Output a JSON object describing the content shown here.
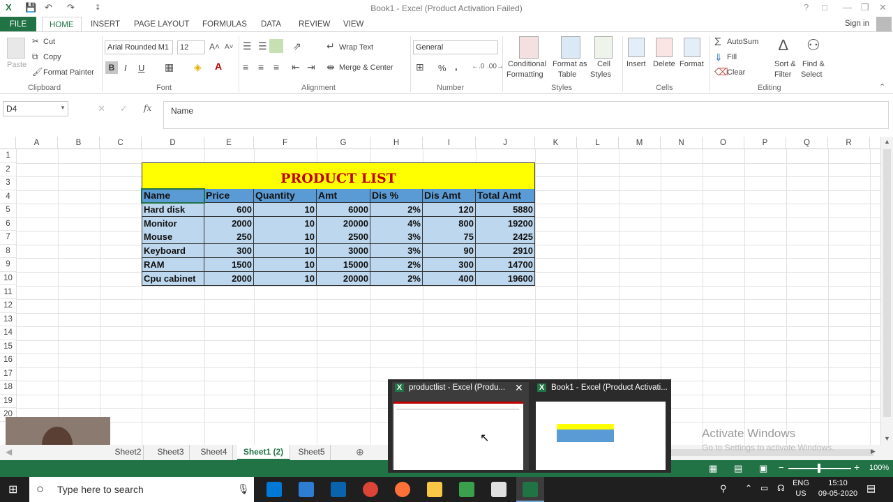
{
  "window": {
    "title": "Book1 - Excel (Product Activation Failed)",
    "sign_in": "Sign in"
  },
  "ribbon_tabs": [
    "FILE",
    "HOME",
    "INSERT",
    "PAGE LAYOUT",
    "FORMULAS",
    "DATA",
    "REVIEW",
    "VIEW"
  ],
  "clipboard": {
    "paste": "Paste",
    "cut": "Cut",
    "copy": "Copy",
    "format_painter": "Format Painter",
    "label": "Clipboard"
  },
  "font": {
    "name": "Arial Rounded M1",
    "size": "12",
    "label": "Font",
    "bold": "B",
    "italic": "I",
    "underline": "U"
  },
  "alignment": {
    "wrap_text": "Wrap Text",
    "merge_center": "Merge & Center",
    "label": "Alignment"
  },
  "number": {
    "format": "General",
    "label": "Number",
    "percent": "%",
    "comma": ","
  },
  "styles": {
    "conditional": "Conditional",
    "formatting": "Formatting",
    "format_as": "Format as",
    "table": "Table",
    "cell": "Cell",
    "cell_styles": "Styles",
    "label": "Styles"
  },
  "cells": {
    "insert": "Insert",
    "delete": "Delete",
    "format": "Format",
    "label": "Cells"
  },
  "editing": {
    "autosum": "AutoSum",
    "fill": "Fill",
    "clear": "Clear",
    "sort": "Sort &",
    "filter": "Filter",
    "find": "Find &",
    "select": "Select",
    "label": "Editing"
  },
  "formula_bar": {
    "name_box": "D4",
    "fx": "fx",
    "content": "Name"
  },
  "columns": [
    "A",
    "B",
    "C",
    "D",
    "E",
    "F",
    "G",
    "H",
    "I",
    "J",
    "K",
    "L",
    "M",
    "N",
    "O",
    "P",
    "Q",
    "R"
  ],
  "rows": [
    "1",
    "2",
    "3",
    "4",
    "5",
    "6",
    "7",
    "8",
    "9",
    "10",
    "11",
    "12",
    "13",
    "14",
    "15",
    "16",
    "17",
    "18",
    "19",
    "20"
  ],
  "table": {
    "title": "PRODUCT LIST",
    "headers": [
      "Name",
      "Price",
      "Quantity",
      "Amt",
      "Dis %",
      "Dis Amt",
      "Total Amt"
    ],
    "rows": [
      [
        "Hard disk",
        "600",
        "10",
        "6000",
        "2%",
        "120",
        "5880"
      ],
      [
        "Monitor",
        "2000",
        "10",
        "20000",
        "4%",
        "800",
        "19200"
      ],
      [
        "Mouse",
        "250",
        "10",
        "2500",
        "3%",
        "75",
        "2425"
      ],
      [
        "Keyboard",
        "300",
        "10",
        "3000",
        "3%",
        "90",
        "2910"
      ],
      [
        "RAM",
        "1500",
        "10",
        "15000",
        "2%",
        "300",
        "14700"
      ],
      [
        "Cpu cabinet",
        "2000",
        "10",
        "20000",
        "2%",
        "400",
        "19600"
      ]
    ]
  },
  "sheets": [
    "Sheet2",
    "Sheet3",
    "Sheet4",
    "Sheet1 (2)",
    "Sheet5"
  ],
  "active_sheet": "Sheet1 (2)",
  "zoom": "100%",
  "popup": {
    "win1": "productlist - Excel (Produ...",
    "win2": "Book1 - Excel (Product Activati..."
  },
  "watermark": {
    "line1": "Activate Windows",
    "line2": "Go to Settings to activate Windows."
  },
  "taskbar": {
    "search_placeholder": "Type here to search",
    "lang1": "ENG",
    "lang2": "US",
    "time": "15:10",
    "date": "09-05-2020"
  },
  "colors": {
    "excel_green": "#217346",
    "header_blue": "#5b9bd5",
    "data_blue": "#bdd7ee",
    "title_yellow": "#ffff00",
    "title_red": "#c00000"
  }
}
